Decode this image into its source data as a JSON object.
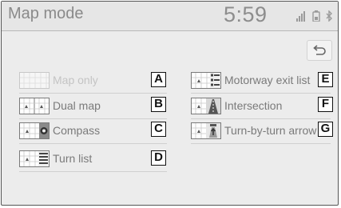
{
  "header": {
    "title": "Map mode",
    "time": "5:59",
    "status_icons": [
      "signal-icon",
      "battery-icon",
      "bluetooth-icon"
    ]
  },
  "back_button": {
    "icon": "back-arrow-icon"
  },
  "menu": {
    "items": [
      {
        "id": "map-only",
        "label": "Map only",
        "badge": "A",
        "enabled": false,
        "thumb_icon": "map-only-icon"
      },
      {
        "id": "dual-map",
        "label": "Dual map",
        "badge": "B",
        "enabled": true,
        "thumb_icon": "dual-map-icon"
      },
      {
        "id": "compass",
        "label": "Compass",
        "badge": "C",
        "enabled": true,
        "thumb_icon": "compass-icon"
      },
      {
        "id": "turn-list",
        "label": "Turn list",
        "badge": "D",
        "enabled": true,
        "thumb_icon": "turn-list-icon"
      },
      {
        "id": "motorway-exit-list",
        "label": "Motorway exit list",
        "badge": "E",
        "enabled": true,
        "thumb_icon": "motorway-exit-list-icon"
      },
      {
        "id": "intersection",
        "label": "Intersection",
        "badge": "F",
        "enabled": true,
        "thumb_icon": "intersection-icon"
      },
      {
        "id": "turn-by-turn-arrow",
        "label": "Turn-by-turn arrow",
        "badge": "G",
        "enabled": true,
        "thumb_icon": "turn-by-turn-arrow-icon"
      }
    ]
  }
}
